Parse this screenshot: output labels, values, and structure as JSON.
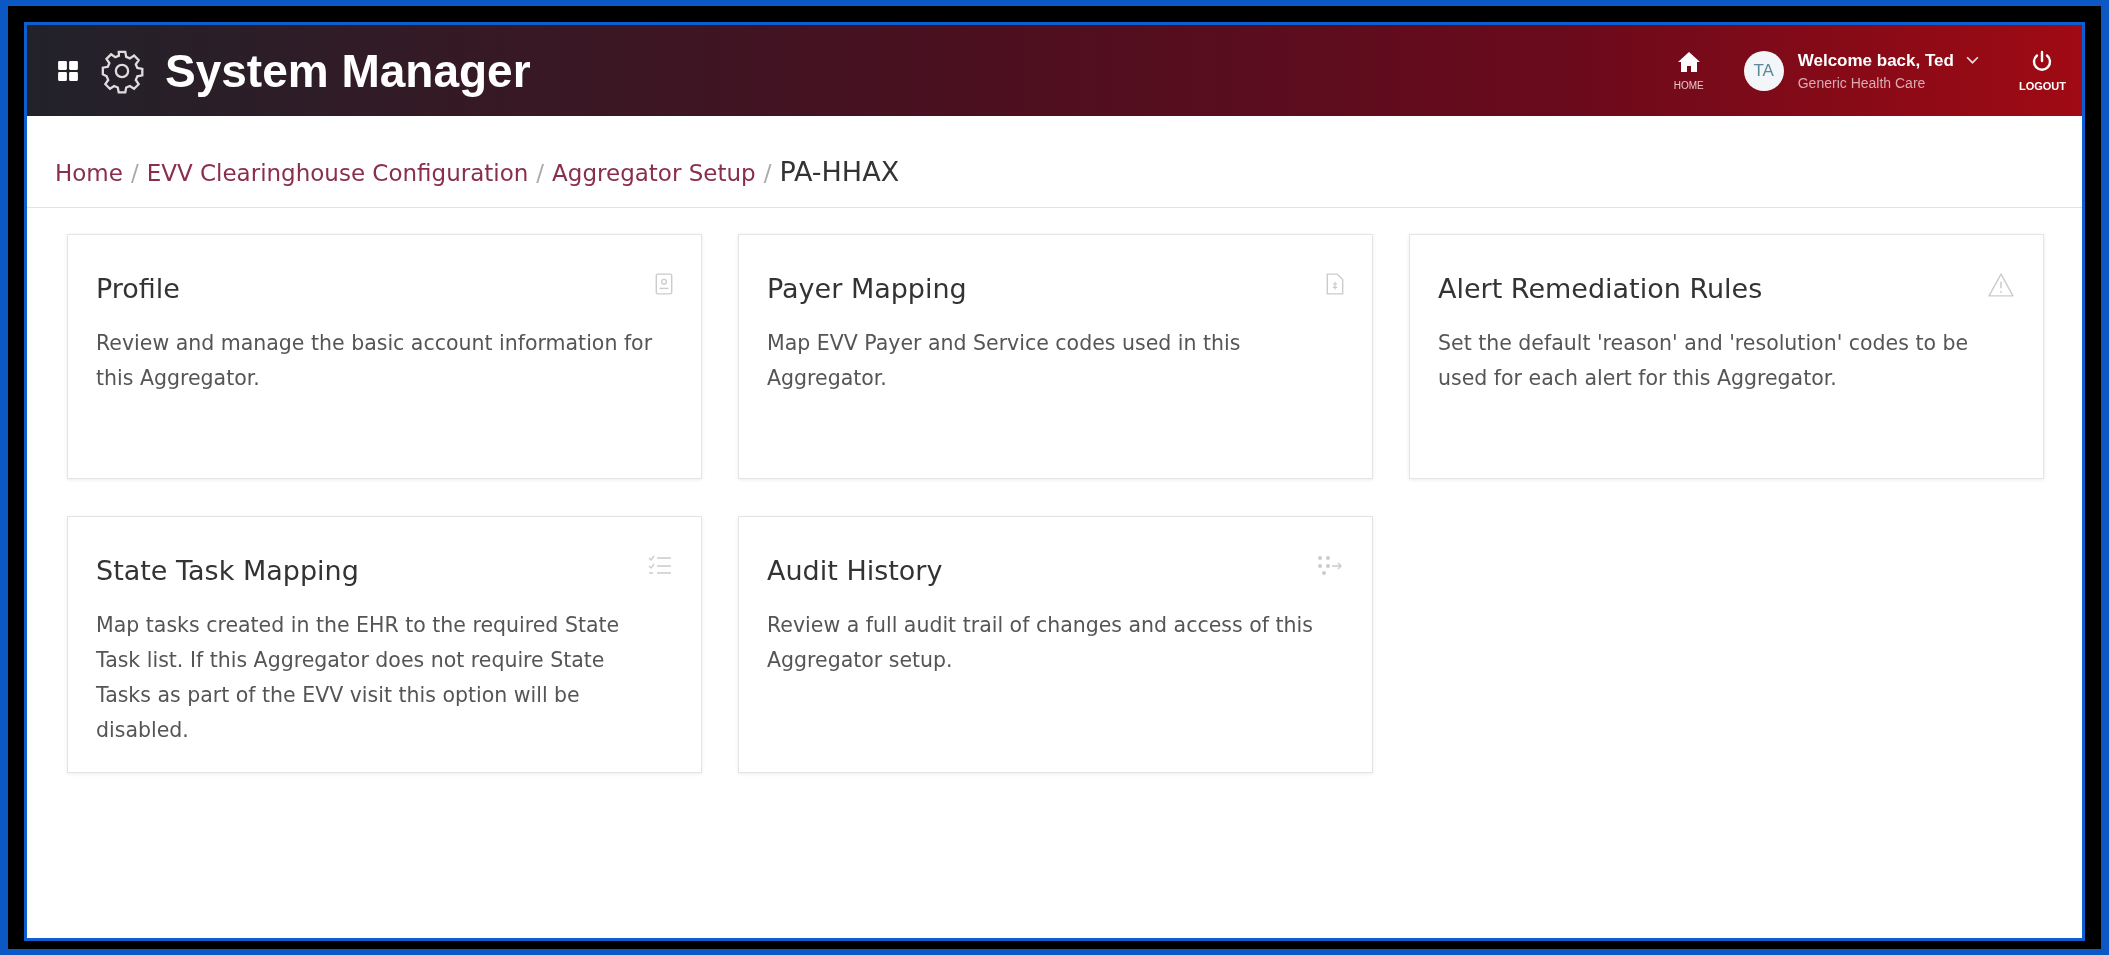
{
  "header": {
    "title": "System Manager",
    "home_label": "HOME",
    "avatar": "TA",
    "welcome": "Welcome back, Ted",
    "organization": "Generic Health Care",
    "logout_label": "LOGOUT"
  },
  "breadcrumb": {
    "separator": "/",
    "items": [
      {
        "label": "Home",
        "current": false
      },
      {
        "label": "EVV Clearinghouse Configuration",
        "current": false
      },
      {
        "label": "Aggregator Setup",
        "current": false
      },
      {
        "label": "PA-HHAX",
        "current": true
      }
    ]
  },
  "cards": [
    {
      "title": "Profile",
      "description": "Review and manage the basic account information for this Aggregator."
    },
    {
      "title": "Payer Mapping",
      "description": "Map EVV Payer and Service codes used in this Aggregator."
    },
    {
      "title": "Alert Remediation Rules",
      "description": "Set the default 'reason' and 'resolution' codes to be used for each alert for this Aggregator."
    },
    {
      "title": "State Task Mapping",
      "description": "Map tasks created in the EHR to the required State Task list.  If this Aggregator does not require State Tasks as part of the EVV visit this option will be disabled."
    },
    {
      "title": "Audit History",
      "description": "Review a full audit trail of changes and access of this Aggregator setup."
    }
  ]
}
